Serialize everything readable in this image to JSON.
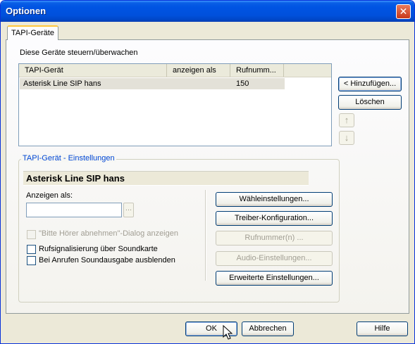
{
  "window": {
    "title": "Optionen"
  },
  "tab": {
    "label": "TAPI-Geräte"
  },
  "panel": {
    "description": "Diese Geräte steuern/überwachen"
  },
  "device_list": {
    "columns": [
      "TAPI-Gerät",
      "anzeigen als",
      "Rufnumm..."
    ],
    "rows": [
      {
        "device": "Asterisk Line  SIP hans",
        "display_as": "",
        "number": "150"
      }
    ]
  },
  "side_buttons": {
    "add": "< Hinzufügen...",
    "delete": "Löschen"
  },
  "settings_group": {
    "legend": "TAPI-Gerät - Einstellungen",
    "device_name": "Asterisk Line  SIP hans",
    "display_as_label": "Anzeigen als:",
    "display_as_value": "",
    "browse_label": "...",
    "checkboxes": {
      "pickup_dialog": "\"Bitte Hörer abnehmen\"-Dialog anzeigen",
      "ring_sound": "Rufsignalisierung über Soundkarte",
      "mute_on_call": "Bei Anrufen Soundausgabe ausblenden"
    },
    "buttons": {
      "dial_settings": "Wähleinstellungen...",
      "driver_config": "Treiber-Konfiguration...",
      "numbers": "Rufnummer(n) ...",
      "audio_settings": "Audio-Einstellungen...",
      "advanced_settings": "Erweiterte Einstellungen..."
    }
  },
  "footer": {
    "ok": "OK",
    "cancel": "Abbrechen",
    "help": "Hilfe"
  },
  "icons": {
    "close": "close-icon",
    "move_up": "arrow-up-icon",
    "move_down": "arrow-down-icon",
    "cursor": "mouse-pointer-icon"
  },
  "colors": {
    "titlebar": "#0054e3",
    "dialog_bg": "#ece9d8",
    "group_legend": "#0046d5",
    "tab_highlight": "#ffc73c"
  }
}
